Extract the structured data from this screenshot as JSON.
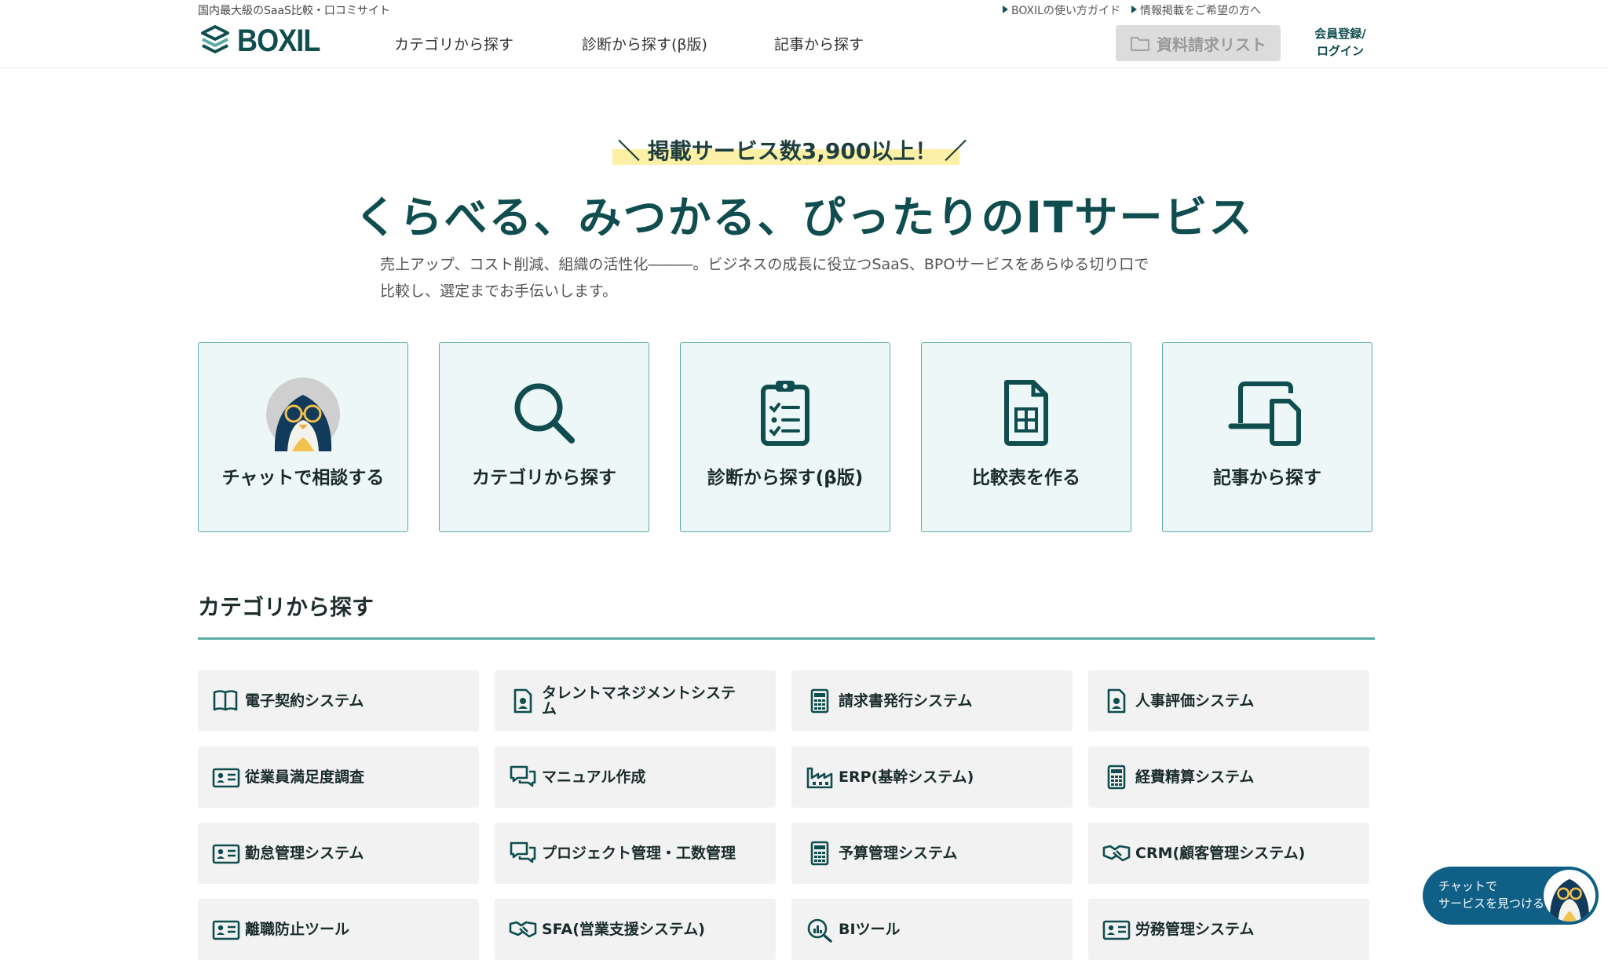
{
  "header": {
    "tagline": "国内最大級のSaaS比較・口コミサイト",
    "logo_text": "BOXIL",
    "nav": [
      "カテゴリから探す",
      "診断から探す(β版)",
      "記事から探す"
    ],
    "top_links": [
      "BOXILの使い方ガイド",
      "情報掲載をご希望の方へ"
    ],
    "request_list_label": "資料請求リスト",
    "login_line1": "会員登録/",
    "login_line2": "ログイン"
  },
  "hero": {
    "badge": "＼ 掲載サービス数3,900以上！ ／",
    "title": "くらべる、みつかる、ぴったりのITサービス",
    "desc_line1": "売上アップ、コスト削減、組織の活性化―――。ビジネスの成長に役立つSaaS、BPOサービスをあらゆる切り口で",
    "desc_line2": "比較し、選定までお手伝いします。"
  },
  "features": [
    {
      "label": "チャットで相談する",
      "icon": "penguin-avatar-icon"
    },
    {
      "label": "カテゴリから探す",
      "icon": "search-icon"
    },
    {
      "label": "診断から探す(β版)",
      "icon": "clipboard-checklist-icon"
    },
    {
      "label": "比較表を作る",
      "icon": "spreadsheet-icon"
    },
    {
      "label": "記事から探す",
      "icon": "devices-icon"
    }
  ],
  "categories_heading": "カテゴリから探す",
  "categories": [
    {
      "label": "電子契約システム",
      "icon": "book-icon"
    },
    {
      "label": "タレントマネジメントシステム",
      "icon": "person-document-icon"
    },
    {
      "label": "請求書発行システム",
      "icon": "calculator-icon"
    },
    {
      "label": "人事評価システム",
      "icon": "person-document-icon"
    },
    {
      "label": "従業員満足度調査",
      "icon": "id-card-icon"
    },
    {
      "label": "マニュアル作成",
      "icon": "chat-bubbles-icon"
    },
    {
      "label": "ERP(基幹システム)",
      "icon": "factory-icon"
    },
    {
      "label": "経費精算システム",
      "icon": "calculator-icon"
    },
    {
      "label": "勤怠管理システム",
      "icon": "id-card-icon"
    },
    {
      "label": "プロジェクト管理・工数管理",
      "icon": "chat-bubbles-icon"
    },
    {
      "label": "予算管理システム",
      "icon": "calculator-icon"
    },
    {
      "label": "CRM(顧客管理システム)",
      "icon": "handshake-icon"
    },
    {
      "label": "離職防止ツール",
      "icon": "id-card-icon"
    },
    {
      "label": "SFA(営業支援システム)",
      "icon": "handshake-icon"
    },
    {
      "label": "BIツール",
      "icon": "chart-search-icon"
    },
    {
      "label": "労務管理システム",
      "icon": "id-card-icon"
    }
  ],
  "chat_widget": {
    "line1": "チャットで",
    "line2": "サービスを見つける"
  },
  "colors": {
    "brand": "#0f4d4f",
    "accent": "#5aaaa7",
    "card_bg": "#eef7f7",
    "highlight": "#fbf0a6",
    "chat": "#0f5f87"
  }
}
